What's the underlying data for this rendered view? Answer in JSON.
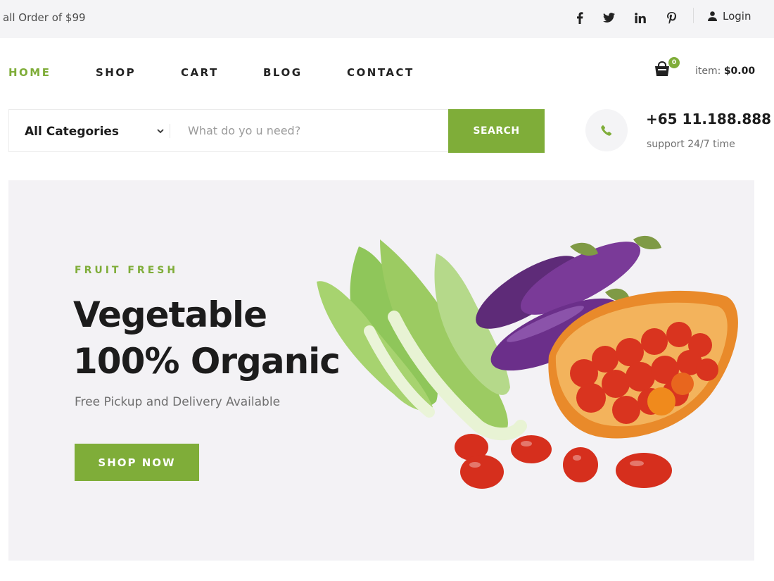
{
  "topbar": {
    "promo": "all Order of $99",
    "social": [
      "facebook-icon",
      "twitter-icon",
      "linkedin-icon",
      "pinterest-icon"
    ],
    "login_label": "Login"
  },
  "nav": {
    "items": [
      {
        "label": "HOME",
        "active": true
      },
      {
        "label": "SHOP",
        "active": false
      },
      {
        "label": "CART",
        "active": false
      },
      {
        "label": "BLOG",
        "active": false
      },
      {
        "label": "CONTACT",
        "active": false
      }
    ]
  },
  "cart": {
    "count": "0",
    "total_label": "item:",
    "total_value": "$0.00"
  },
  "search": {
    "category_label": "All Categories",
    "placeholder": "What do yo u need?",
    "value": "",
    "button_label": "SEARCH"
  },
  "contact": {
    "phone": "+65 11.188.888",
    "support": "support 24/7 time"
  },
  "hero": {
    "eyebrow": "FRUIT FRESH",
    "title_line1": "Vegetable",
    "title_line2": "100% Organic",
    "subtitle": "Free Pickup and Delivery Available",
    "cta_label": "SHOP NOW"
  },
  "colors": {
    "accent": "#7fad39",
    "text": "#1c1c1c",
    "hero_bg": "#f3f2f5",
    "topbar_bg": "#f4f4f6"
  }
}
